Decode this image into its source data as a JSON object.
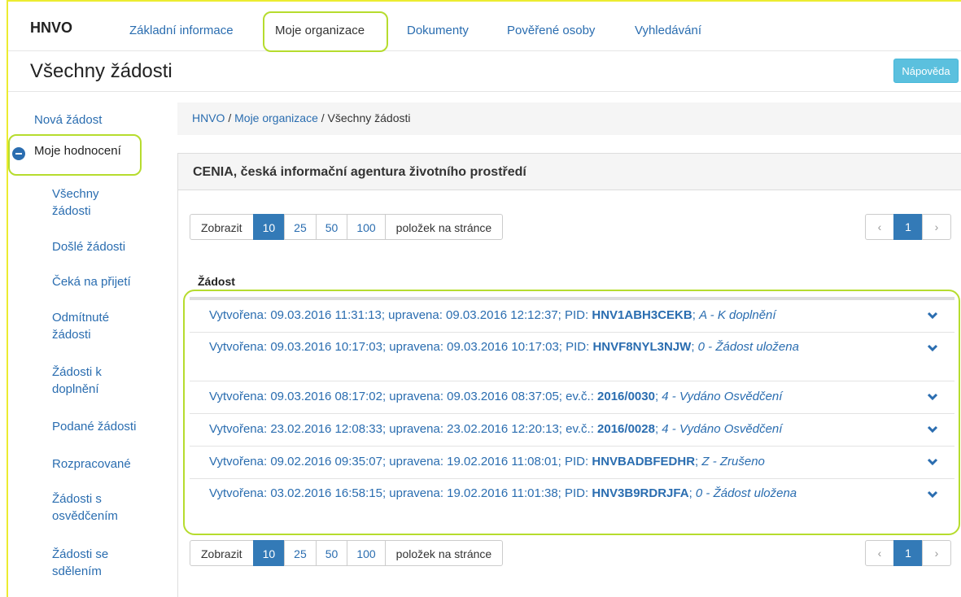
{
  "brand": "HNVO",
  "nav": {
    "items": [
      "Základní informace",
      "Moje organizace",
      "Dokumenty",
      "Pověřené osoby",
      "Vyhledávání"
    ]
  },
  "page": {
    "title": "Všechny žádosti",
    "help_label": "Nápověda"
  },
  "sidebar": {
    "new_request": "Nová žádost",
    "group_label": "Moje hodnocení",
    "items": [
      {
        "line1": "Všechny",
        "line2": "žádosti"
      },
      {
        "line1": "Došlé žádosti",
        "line2": ""
      },
      {
        "line1": "Čeká na přijetí",
        "line2": ""
      },
      {
        "line1": "Odmítnuté",
        "line2": "žádosti"
      },
      {
        "line1": "Žádosti k",
        "line2": "doplnění"
      },
      {
        "line1": "Podané žádosti",
        "line2": ""
      },
      {
        "line1": "Rozpracované",
        "line2": ""
      },
      {
        "line1": "Žádosti s",
        "line2": "osvědčením"
      },
      {
        "line1": "Žádosti se",
        "line2": "sdělením"
      }
    ]
  },
  "breadcrumb": {
    "home": "HNVO",
    "sep": " / ",
    "org": "Moje organizace",
    "current": "Všechny žádosti"
  },
  "panel": {
    "heading": "CENIA, česká informační agentura životního prostředí"
  },
  "pagination": {
    "show_label": "Zobrazit",
    "sizes": [
      "10",
      "25",
      "50",
      "100"
    ],
    "selected_size": "10",
    "per_page_label": "položek na stránce",
    "prev": "‹",
    "page": "1",
    "next": "›"
  },
  "table": {
    "column_header": "Žádost",
    "rows": [
      {
        "pre": "Vytvořena: 09.03.2016 11:31:13; upravena: 09.03.2016 12:12:37; PID: ",
        "id": "HNV1ABH3CEKB",
        "sep": "; ",
        "status": "A - K doplnění"
      },
      {
        "pre": "Vytvořena: 09.03.2016 10:17:03; upravena: 09.03.2016 10:17:03; PID: ",
        "id": "HNVF8NYL3NJW",
        "sep": "; ",
        "status": "0 - Žádost uložena"
      },
      {
        "pre": "Vytvořena: 09.03.2016 08:17:02; upravena: 09.03.2016 08:37:05; ev.č.: ",
        "id": "2016/0030",
        "sep": "; ",
        "status": "4 - Vydáno Osvědčení"
      },
      {
        "pre": "Vytvořena: 23.02.2016 12:08:33; upravena: 23.02.2016 12:20:13; ev.č.: ",
        "id": "2016/0028",
        "sep": "; ",
        "status": "4 - Vydáno Osvědčení"
      },
      {
        "pre": "Vytvořena: 09.02.2016 09:35:07; upravena: 19.02.2016 11:08:01; PID: ",
        "id": "HNVBADBFEDHR",
        "sep": "; ",
        "status": "Z - Zrušeno"
      },
      {
        "pre": "Vytvořena: 03.02.2016 16:58:15; upravena: 19.02.2016 11:01:38; PID: ",
        "id": "HNV3B9RDRJFA",
        "sep": "; ",
        "status": "0 - Žádost uložena"
      }
    ]
  },
  "colors": {
    "link": "#2a6db0",
    "primary": "#337ab7",
    "info": "#5bc0de",
    "highlight": "#b6dc2e"
  }
}
